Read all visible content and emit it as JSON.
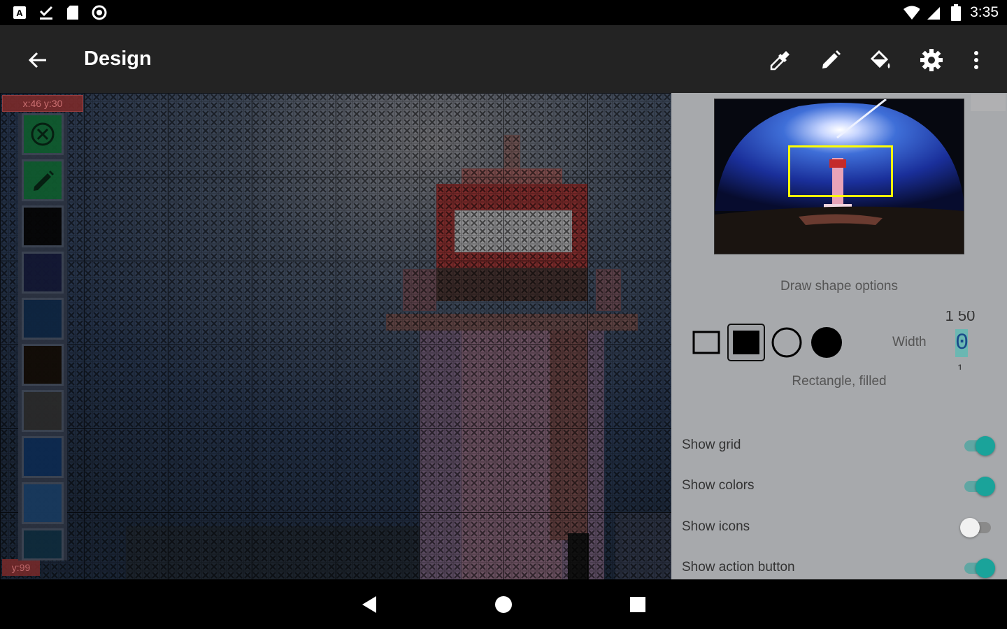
{
  "status_bar": {
    "left_icons": [
      "font-notification-icon",
      "download-done-icon",
      "sd-card-icon",
      "sync-circle-icon"
    ],
    "right_icons": [
      "wifi-icon",
      "cell-signal-icon",
      "battery-icon"
    ],
    "time": "3:35"
  },
  "app_bar": {
    "title": "Design",
    "actions": [
      "eyedropper-icon",
      "pencil-icon",
      "paint-bucket-icon",
      "settings-icon",
      "more-vert-icon"
    ]
  },
  "canvas": {
    "coords_label": "x:46 y:30",
    "y_label": "y:99"
  },
  "palette": {
    "items": [
      {
        "type": "cancel",
        "icon": "cancel-circle-icon",
        "color": "#0f5a2e"
      },
      {
        "type": "draw",
        "icon": "pencil-icon",
        "color": "#0f5a2e"
      },
      {
        "type": "color",
        "color": "#050505"
      },
      {
        "type": "color",
        "color": "#131733"
      },
      {
        "type": "color",
        "color": "#0e2540"
      },
      {
        "type": "color",
        "color": "#120c06"
      },
      {
        "type": "color",
        "color": "#2a2a2a"
      },
      {
        "type": "color",
        "color": "#0d2a50"
      },
      {
        "type": "color",
        "color": "#183a5e"
      },
      {
        "type": "color",
        "color": "#0f2b3c"
      }
    ]
  },
  "panel": {
    "section_title": "Draw shape options",
    "shapes": [
      "rectangle-outline-icon",
      "rectangle-filled-icon",
      "circle-outline-icon",
      "circle-filled-icon"
    ],
    "selected_shape_index": 1,
    "width_label": "Width",
    "width_value": "0",
    "width_above": "1 50",
    "width_below": "1",
    "shape_caption": "Rectangle, filled",
    "toggles": [
      {
        "label": "Show grid",
        "on": true
      },
      {
        "label": "Show colors",
        "on": true
      },
      {
        "label": "Show icons",
        "on": false
      },
      {
        "label": "Show action button",
        "on": true
      }
    ],
    "accent_color": "#1aa39a"
  },
  "nav_bar": {
    "buttons": [
      "back-triangle-icon",
      "home-circle-icon",
      "recents-square-icon"
    ]
  }
}
